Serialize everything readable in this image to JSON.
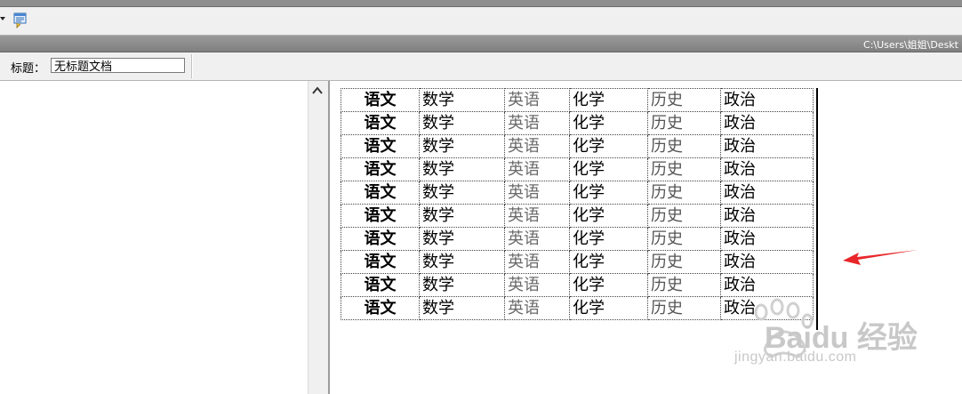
{
  "toolbar": {
    "icon": "document-view-icon"
  },
  "pathbar": {
    "path": "C:\\Users\\姐姐\\Deskt"
  },
  "titlebar": {
    "label": "标题：",
    "value": "无标题文档"
  },
  "table": {
    "rows": [
      [
        "语文",
        "数学",
        "英语",
        "化学",
        "历史",
        "政治"
      ],
      [
        "语文",
        "数学",
        "英语",
        "化学",
        "历史",
        "政治"
      ],
      [
        "语文",
        "数学",
        "英语",
        "化学",
        "历史",
        "政治"
      ],
      [
        "语文",
        "数学",
        "英语",
        "化学",
        "历史",
        "政治"
      ],
      [
        "语文",
        "数学",
        "英语",
        "化学",
        "历史",
        "政治"
      ],
      [
        "语文",
        "数学",
        "英语",
        "化学",
        "历史",
        "政治"
      ],
      [
        "语文",
        "数学",
        "英语",
        "化学",
        "历史",
        "政治"
      ],
      [
        "语文",
        "数学",
        "英语",
        "化学",
        "历史",
        "政治"
      ],
      [
        "语文",
        "数学",
        "英语",
        "化学",
        "历史",
        "政治"
      ],
      [
        "语文",
        "数学",
        "英语",
        "化学",
        "历史",
        "政治"
      ]
    ]
  },
  "annotation": {
    "arrow_color": "#e8262a"
  },
  "watermark": {
    "brand": "Baidu 经验",
    "url": "jingyan.baidu.com"
  }
}
